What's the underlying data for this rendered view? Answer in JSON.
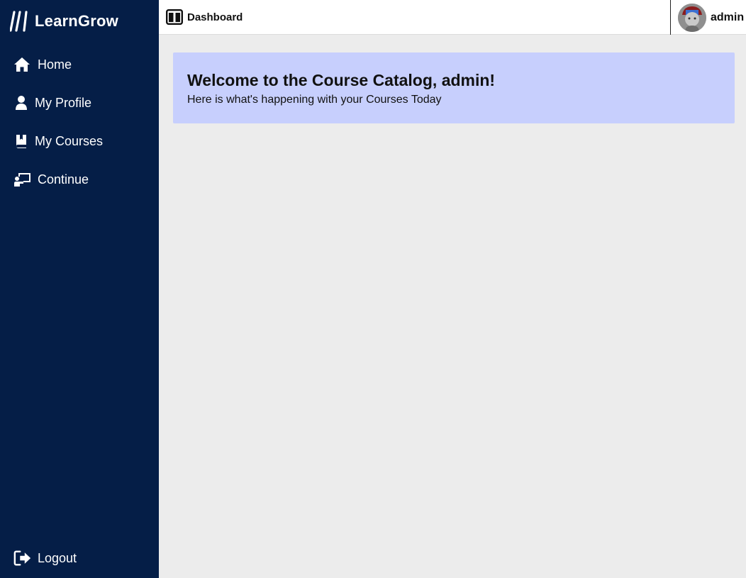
{
  "brand": {
    "name": "LearnGrow",
    "icon": "slashes-logo-icon"
  },
  "sidebar": {
    "items": [
      {
        "label": "Home",
        "icon": "home-icon"
      },
      {
        "label": "My Profile",
        "icon": "user-icon"
      },
      {
        "label": "My Courses",
        "icon": "book-icon"
      },
      {
        "label": "Continue",
        "icon": "teacher-board-icon"
      }
    ],
    "logout": {
      "label": "Logout",
      "icon": "logout-icon"
    }
  },
  "header": {
    "title": "Dashboard",
    "title_icon": "columns-icon",
    "user": {
      "name": "admin",
      "avatar": "user-avatar"
    }
  },
  "main": {
    "welcome": {
      "title": "Welcome to the Course Catalog, admin!",
      "subtitle": "Here is what's happening with your Courses Today"
    }
  },
  "colors": {
    "sidebar_bg": "#051e47",
    "content_bg": "#ececec",
    "welcome_bg": "#c7cffd"
  }
}
